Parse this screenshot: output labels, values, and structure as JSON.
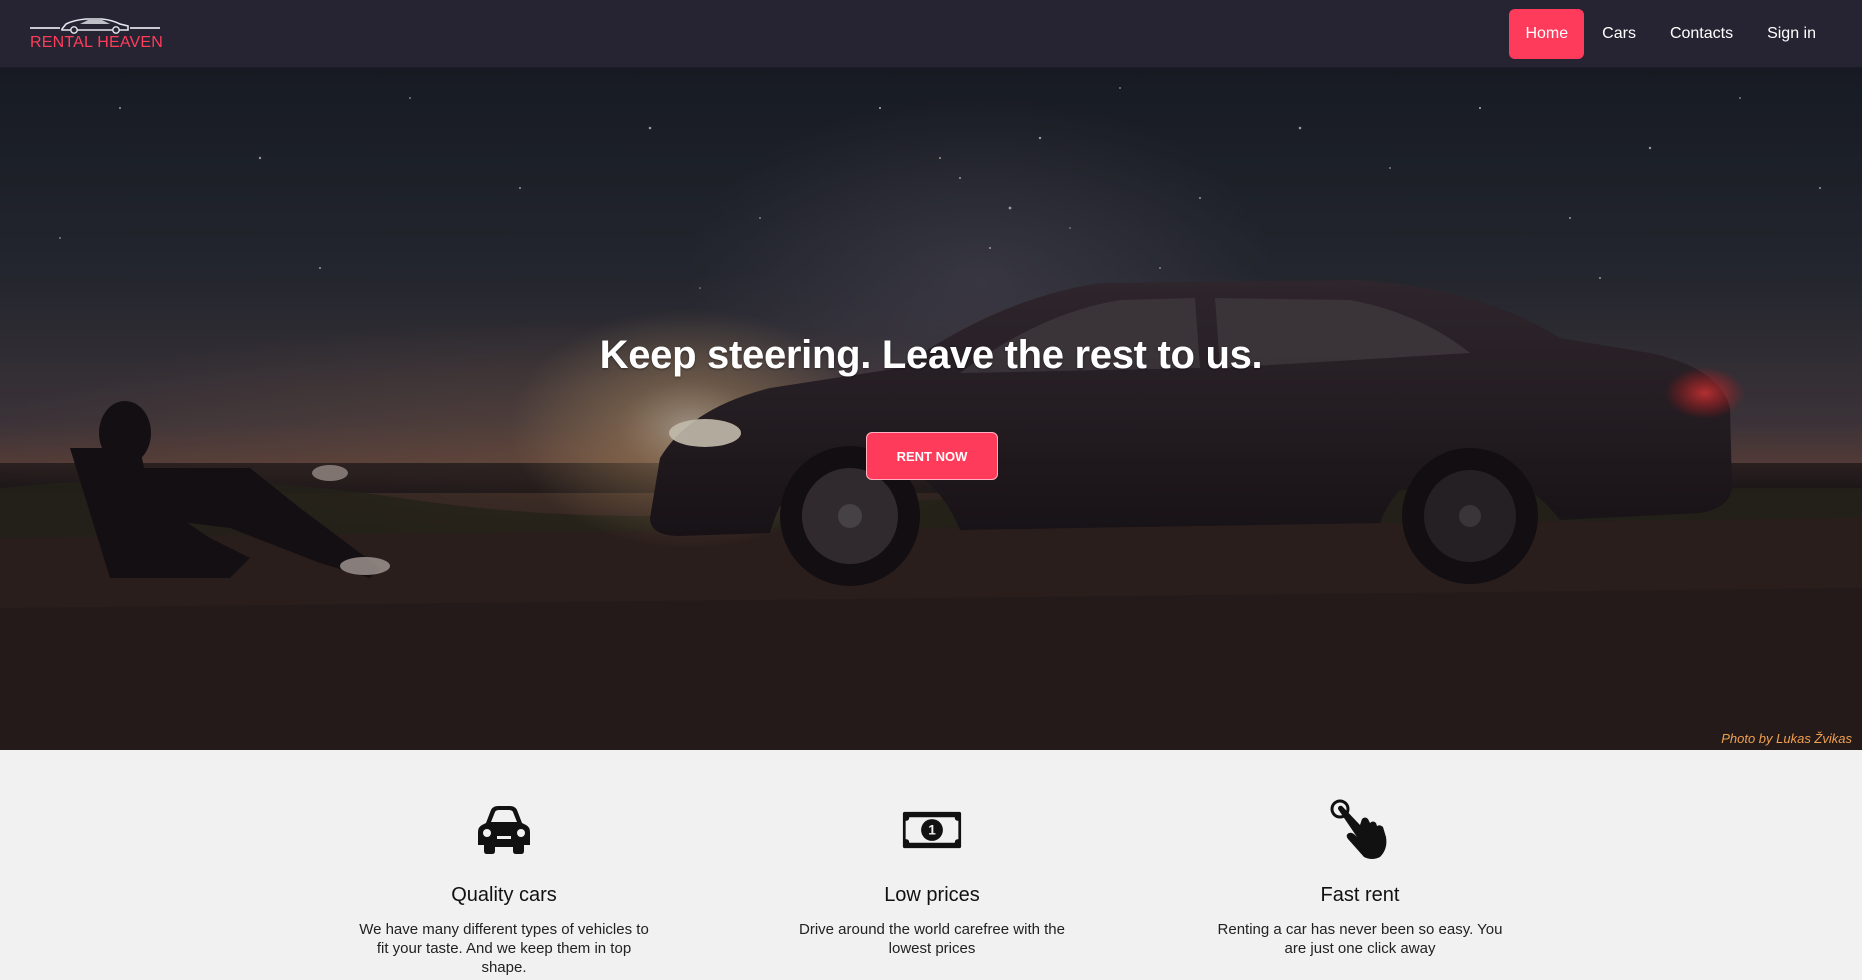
{
  "brand": {
    "name": "RENTAL HEAVEN",
    "logo_icon": "car-icon",
    "accent": "#ff3b5c"
  },
  "nav": {
    "items": [
      {
        "label": "Home",
        "active": true
      },
      {
        "label": "Cars",
        "active": false
      },
      {
        "label": "Contacts",
        "active": false
      },
      {
        "label": "Sign in",
        "active": false
      }
    ]
  },
  "hero": {
    "title": "Keep steering. Leave the rest to us.",
    "cta_label": "RENT NOW",
    "photo_credit": "Photo by Lukas Žvikas"
  },
  "features": [
    {
      "icon": "car-icon",
      "title": "Quality cars",
      "text": "We have many different types of vehicles to fit your taste. And we keep them in top shape."
    },
    {
      "icon": "banknote-icon",
      "title": "Low prices",
      "text": "Drive around the world carefree with the lowest prices"
    },
    {
      "icon": "pointing-hand-icon",
      "title": "Fast rent",
      "text": "Renting a car has never been so easy. You are just one click away"
    }
  ]
}
